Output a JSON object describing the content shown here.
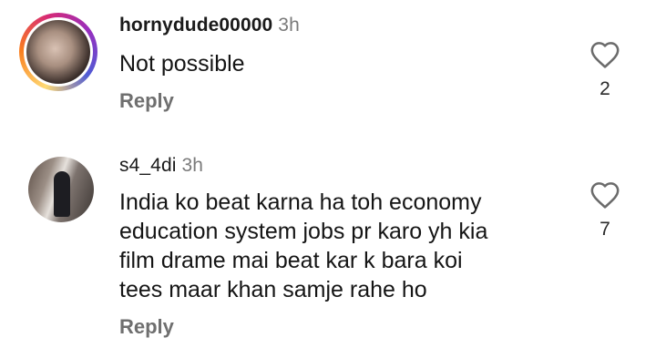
{
  "comments": [
    {
      "username": "hornydude00000",
      "time": "3h",
      "text_lines": [
        "Not possible"
      ],
      "reply_label": "Reply",
      "like_count": "2"
    },
    {
      "username": "s4_4di",
      "time": "3h",
      "text_lines": [
        "India ko beat karna ha toh economy",
        "education system jobs pr karo yh kia",
        "film drame mai beat kar k bara koi",
        "tees maar khan samje rahe ho"
      ],
      "reply_label": "Reply",
      "like_count": "7"
    }
  ],
  "icons": {
    "like": "heart-outline-icon"
  },
  "colors": {
    "story_ring": [
      "#feda75",
      "#fa7e1e",
      "#d62976",
      "#962fbf",
      "#4f5bd5"
    ]
  }
}
